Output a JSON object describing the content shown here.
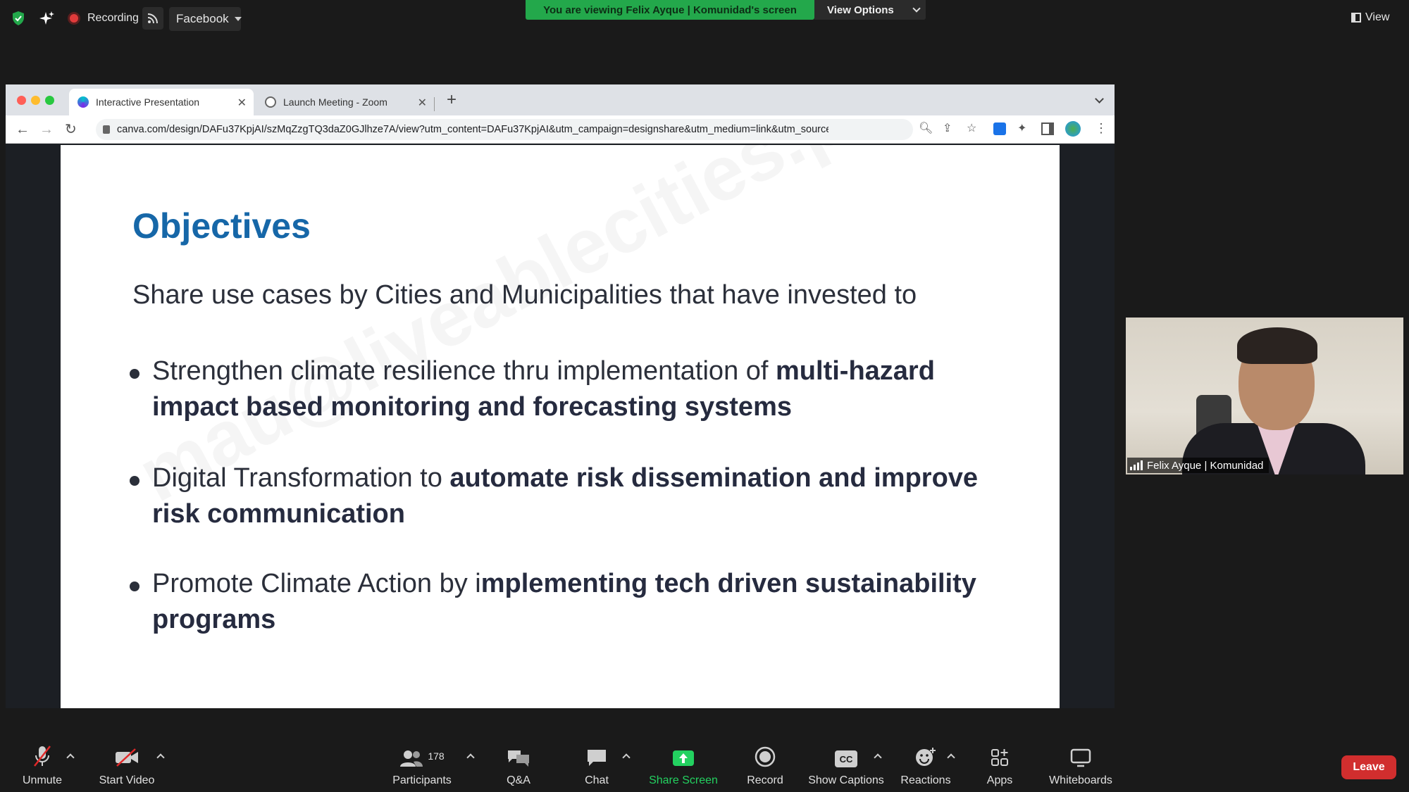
{
  "topbar": {
    "recording_label": "Recording",
    "stream_target": "Facebook",
    "viewing_banner": "You are viewing Felix Ayque | Komunidad's screen",
    "view_options_label": "View Options",
    "view_label": "View"
  },
  "browser": {
    "tabs": [
      {
        "title": "Interactive Presentation",
        "active": true
      },
      {
        "title": "Launch Meeting - Zoom",
        "active": false
      }
    ],
    "url": "canva.com/design/DAFu37KpjAI/szMqZzgTQ3daZ0GJlhze7A/view?utm_content=DAFu37KpjAI&utm_campaign=designshare&utm_medium=link&utm_source..."
  },
  "slide": {
    "title": "Objectives",
    "intro": "Share use cases by Cities and Municipalities that have invested to",
    "watermark": "mau@liveablecities.ph",
    "bullets": [
      {
        "plain": "Strengthen climate resilience thru implementation of ",
        "bold": "multi-hazard impact based monitoring and forecasting systems"
      },
      {
        "plain": "Digital Transformation to ",
        "bold": "automate risk dissemination and improve risk communication"
      },
      {
        "plain": "Promote Climate Action by i",
        "bold": "mplementing tech driven sustainability programs"
      }
    ]
  },
  "video": {
    "participant_name": "Felix Ayque | Komunidad"
  },
  "toolbar": {
    "unmute": "Unmute",
    "start_video": "Start Video",
    "participants": "Participants",
    "participant_count": "178",
    "qa": "Q&A",
    "chat": "Chat",
    "share_screen": "Share Screen",
    "record": "Record",
    "show_captions": "Show Captions",
    "captions_icon_text": "CC",
    "reactions": "Reactions",
    "apps": "Apps",
    "whiteboards": "Whiteboards",
    "leave": "Leave"
  },
  "colors": {
    "banner_green": "#23a84b",
    "share_green": "#23d160",
    "leave_red": "#d12e2e",
    "slide_title_blue": "#1667a8"
  }
}
